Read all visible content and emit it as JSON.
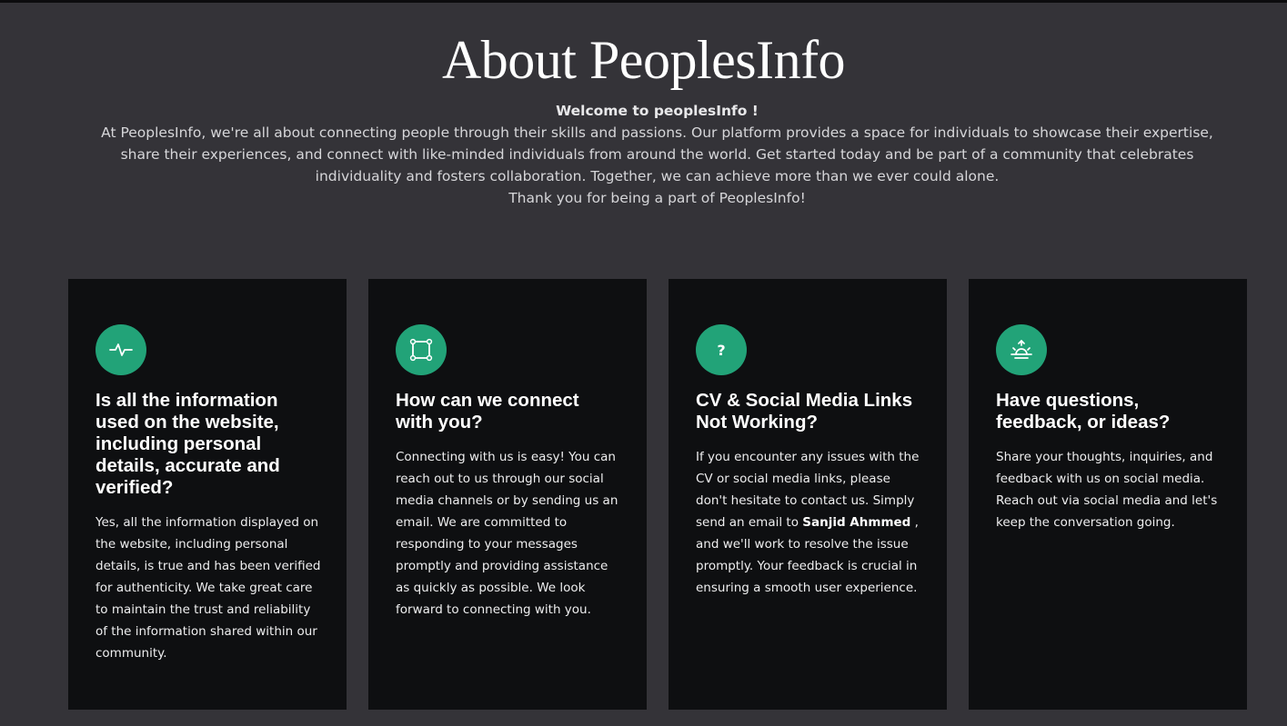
{
  "header": {
    "title": "About PeoplesInfo",
    "welcome": "Welcome to peoplesInfo !",
    "description": "At PeoplesInfo, we're all about connecting people through their skills and passions. Our platform provides a space for individuals to showcase their expertise, share their experiences, and connect with like-minded individuals from around the world. Get started today and be part of a community that celebrates individuality and fosters collaboration. Together, we can achieve more than we ever could alone.",
    "thanks": "Thank you for being a part of PeoplesInfo!"
  },
  "colors": {
    "page_background": "#343338",
    "card_background": "#0e0f11",
    "accent": "#22a378",
    "text": "#ffffff"
  },
  "cards": [
    {
      "icon": "activity-pulse-icon",
      "title": "Is all the information used on the website, including personal details, accurate and verified?",
      "text": "Yes, all the information displayed on the website, including personal details, is true and has been verified for authenticity. We take great care to maintain the trust and reliability of the information shared within our community."
    },
    {
      "icon": "bounding-box-icon",
      "title": "How can we connect with you?",
      "text": "Connecting with us is easy! You can reach out to us through our social media channels or by sending us an email. We are committed to responding to your messages promptly and providing assistance as quickly as possible. We look forward to connecting with you."
    },
    {
      "icon": "question-mark-icon",
      "icon_glyph": "?",
      "title": "CV & Social Media Links Not Working?",
      "text_before": "If you encounter any issues with the CV or social media links, please don't hesitate to contact us. Simply send an email to ",
      "contact_name": "Sanjid Ahmmed",
      "text_after": " , and we'll work to resolve the issue promptly. Your feedback is crucial in ensuring a smooth user experience."
    },
    {
      "icon": "sunrise-icon",
      "title": "Have questions, feedback, or ideas?",
      "text": "Share your thoughts, inquiries, and feedback with us on social media. Reach out via social media and let's keep the conversation going."
    }
  ]
}
